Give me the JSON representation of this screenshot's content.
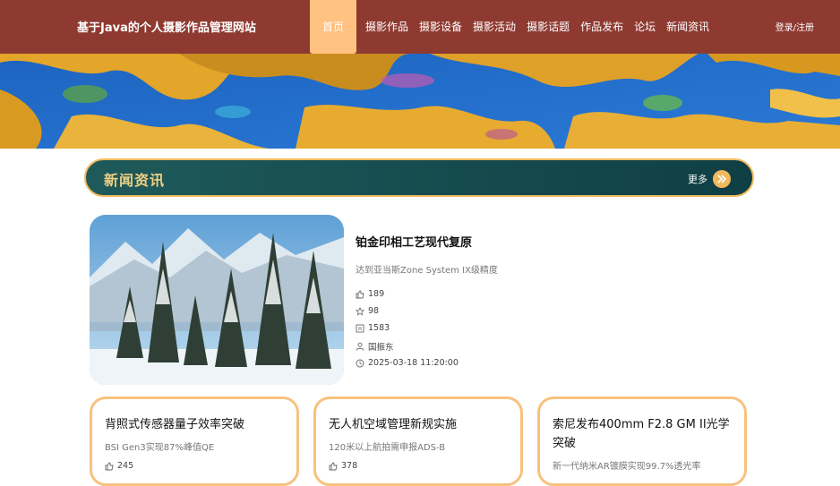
{
  "header": {
    "site_title": "基于Java的个人摄影作品管理网站",
    "nav": [
      "首页",
      "摄影作品",
      "摄影设备",
      "摄影活动",
      "摄影话题",
      "作品发布",
      "论坛",
      "新闻资讯"
    ],
    "login": "登录/注册"
  },
  "section": {
    "title": "新闻资讯",
    "more_label": "更多"
  },
  "featured": {
    "title": "铂金印相工艺现代复原",
    "subtitle": "达到亚当斯Zone System IX级精度",
    "likes": "189",
    "favorites": "98",
    "views": "1583",
    "author": "国振东",
    "datetime": "2025-03-18 11:20:00"
  },
  "cards": [
    {
      "title": "背照式传感器量子效率突破",
      "subtitle": "BSI Gen3实现87%峰值QE",
      "likes": "245"
    },
    {
      "title": "无人机空域管理新规实施",
      "subtitle": "120米以上航拍需申报ADS-B",
      "likes": "378"
    },
    {
      "title": "索尼发布400mm F2.8 GM II光学突破",
      "subtitle": "新一代纳米AR镀膜实现99.7%透光率"
    }
  ],
  "icons": {
    "likes": "thumbs-up-icon",
    "favorites": "star-icon",
    "views": "views-icon",
    "author": "user-icon",
    "datetime": "clock-icon",
    "more": "chevron-double-right-icon"
  },
  "colors": {
    "header_bg": "#8f3a31",
    "nav_active_bg": "#ffc281",
    "section_bar_bg": "#17494d",
    "section_title": "#f0d081",
    "accent": "#f2b85d",
    "card_border": "#f7c27d"
  }
}
